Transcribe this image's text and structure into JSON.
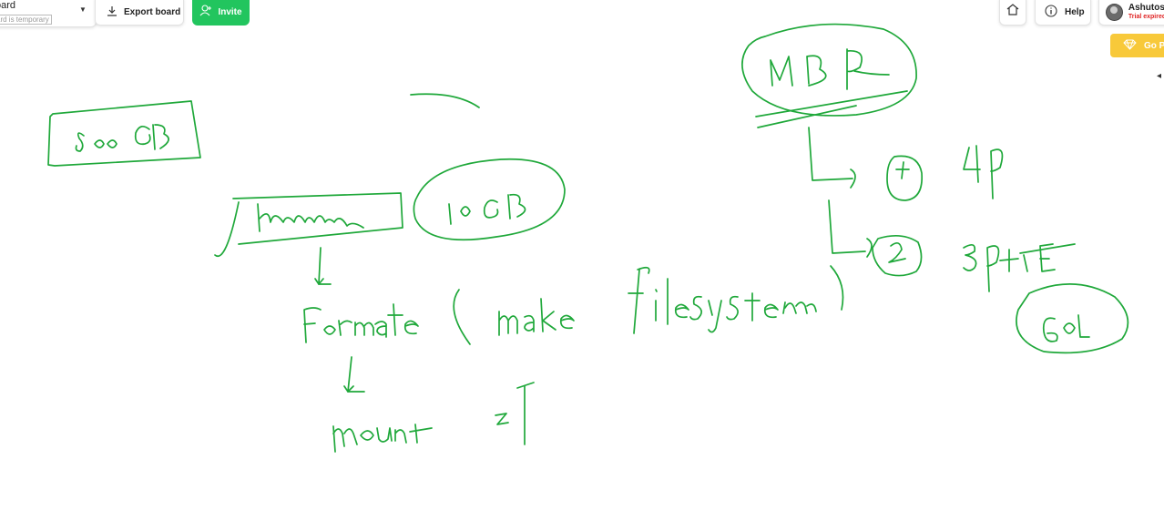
{
  "toolbar": {
    "board_label": "oard",
    "board_temp_label": "ard is temporary",
    "export_label": "Export board",
    "invite_label": "Invite",
    "help_label": "Help",
    "user_name": "Ashutosh",
    "user_status": "Trial expired",
    "go_label": "Go P"
  },
  "colors": {
    "ink": "#1fa83a",
    "invite_bg": "#22c55e",
    "go_bg": "#f8c93a",
    "status_red": "#e02424"
  },
  "icons": {
    "export": "download-icon",
    "invite": "add-user-icon",
    "home": "home-icon",
    "help": "info-icon",
    "go": "diamond-icon"
  },
  "whiteboard": {
    "notes": [
      "500GB",
      "10GB",
      "MBR",
      "1",
      "4P",
      "2",
      "3P+1E",
      "60L",
      "Formate ( make file system )",
      "mount",
      "Z"
    ]
  }
}
